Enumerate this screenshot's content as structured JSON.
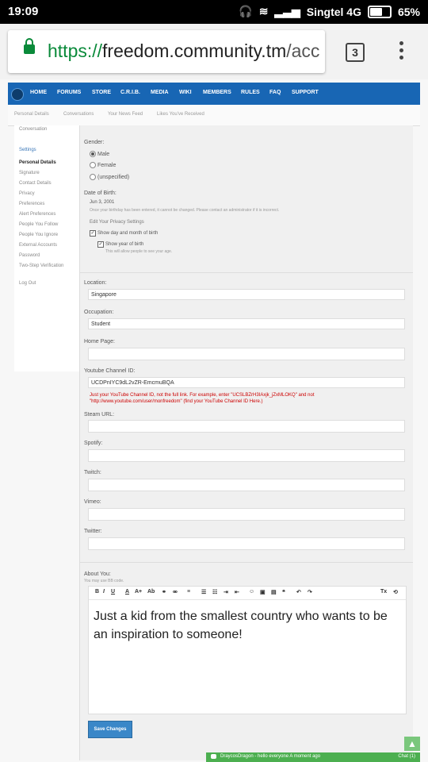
{
  "status": {
    "time": "19:09",
    "carrier": "Singtel 4G",
    "battery": "65%"
  },
  "browser": {
    "url_scheme": "https://",
    "url_host": "freedom.community.tm",
    "url_path": "/acc",
    "tab_count": "3"
  },
  "nav": {
    "items": [
      "HOME",
      "FORUMS",
      "STORE",
      "C.R.I.B.",
      "MEDIA",
      "WIKI",
      "MEMBERS",
      "RULES",
      "FAQ",
      "SUPPORT"
    ]
  },
  "subnav": {
    "items": [
      "Personal Details",
      "Conversations",
      "Your News Feed",
      "Likes You've Received"
    ]
  },
  "sidebar": {
    "top_item": "Conversation",
    "section": "Settings",
    "items": [
      "Personal Details",
      "Signature",
      "Contact Details",
      "Privacy",
      "Preferences",
      "Alert Preferences",
      "People You Follow",
      "People You Ignore",
      "External Accounts",
      "Password",
      "Two-Step Verification"
    ],
    "logout": "Log Out"
  },
  "form": {
    "gender_label": "Gender:",
    "gender_options": [
      "Male",
      "Female",
      "(unspecified)"
    ],
    "dob_label": "Date of Birth:",
    "dob_value": "Jun 3, 2001",
    "dob_note": "Once your birthday has been entered, it cannot be changed. Please contact an administrator if it is incorrect.",
    "privacy_label": "Edit Your Privacy Settings",
    "show_dm_label": "Show day and month of birth",
    "show_year_label": "Show year of birth",
    "show_year_note": "This will allow people to see your age.",
    "location_label": "Location:",
    "location_value": "Singapore",
    "occupation_label": "Occupation:",
    "occupation_value": "Student",
    "homepage_label": "Home Page:",
    "youtube_label": "Youtube Channel ID:",
    "youtube_value": "UCDPnIYC9dL2vZR-EmcmuBQA",
    "youtube_hint": "Just your YouTube Channel ID, not the full link. For example, enter \"UCSLBZrH3IAxjk_jZxMLOKQ\" and not \"http://www.youtube.com/user/monfreedom\" (find your YouTube Channel ID Here.)",
    "steam_label": "Steam URL:",
    "spotify_label": "Spotify:",
    "twitch_label": "Twitch:",
    "vimeo_label": "Vimeo:",
    "twitter_label": "Twitter:",
    "about_label": "About You:",
    "about_note": "You may use BB code.",
    "about_text": "Just a kid from the smallest country who wants to be an inspiration to someone!",
    "save_label": "Save Changes"
  },
  "chat": {
    "user": "DraycosDragon",
    "message": "- hello everyone A moment ago",
    "count": "Chat (1)"
  }
}
